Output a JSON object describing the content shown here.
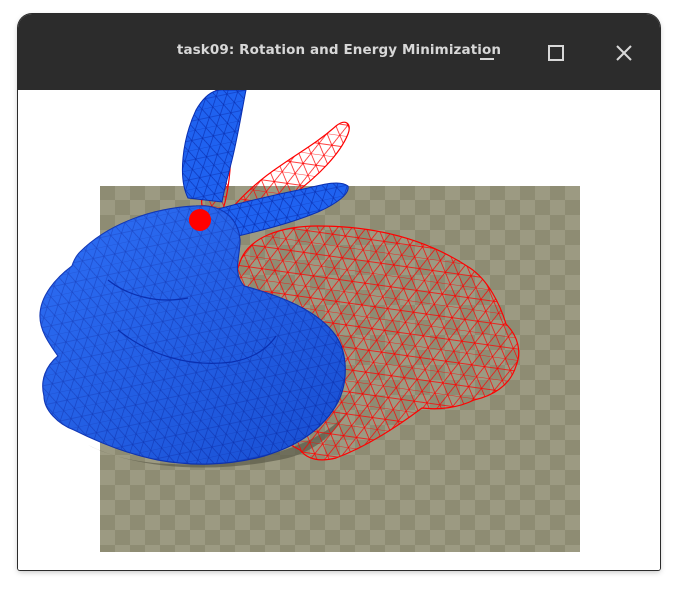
{
  "window": {
    "title": "task09: Rotation and Energy Minimization",
    "controls": [
      "minimize-icon",
      "maximize-icon",
      "close-icon"
    ]
  },
  "viewport": {
    "background": "#ffffff",
    "floor_colors": [
      "#8e8c73",
      "#9c9a82"
    ],
    "solid_mesh_color": "#1f62f0",
    "solid_mesh_edge_color": "#0a2fb0",
    "wireframe_color": "#ff0000",
    "handle_color": "#ff0000"
  }
}
